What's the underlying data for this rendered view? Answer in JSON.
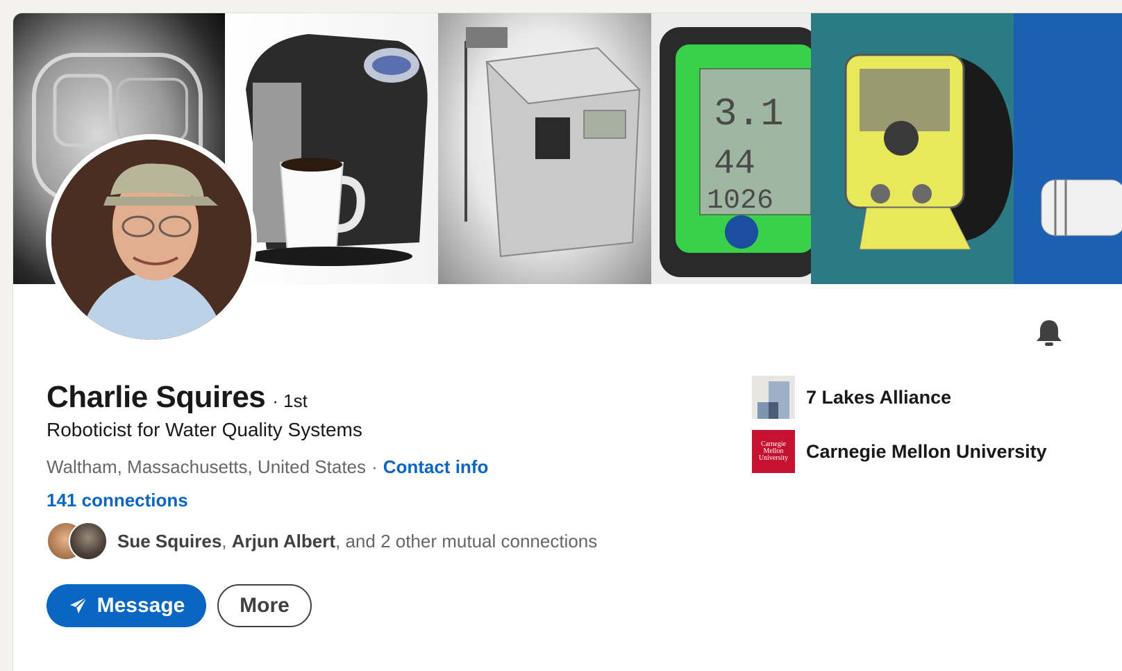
{
  "profile": {
    "name": "Charlie Squires",
    "degree": "· 1st",
    "headline": "Roboticist for Water Quality Systems",
    "location": "Waltham, Massachusetts, United States",
    "location_separator": "·",
    "contact_info": "Contact info",
    "connections": "141 connections"
  },
  "mutual": {
    "names": [
      "Sue Squires",
      "Arjun Albert"
    ],
    "separator": ",",
    "suffix": ", and 2 other mutual connections"
  },
  "actions": {
    "message_label": "Message",
    "more_label": "More"
  },
  "organizations": [
    {
      "name": "7 Lakes Alliance",
      "icon": "lakes-logo"
    },
    {
      "name": "Carnegie Mellon University",
      "icon": "cmu-logo",
      "logo_text": "Carnegie Mellon University"
    }
  ],
  "colors": {
    "link": "#0a66c2",
    "primary_button": "#0a66c2",
    "cmu_red": "#c41230"
  },
  "icons": {
    "notification": "bell-icon",
    "send": "paper-plane-icon"
  }
}
